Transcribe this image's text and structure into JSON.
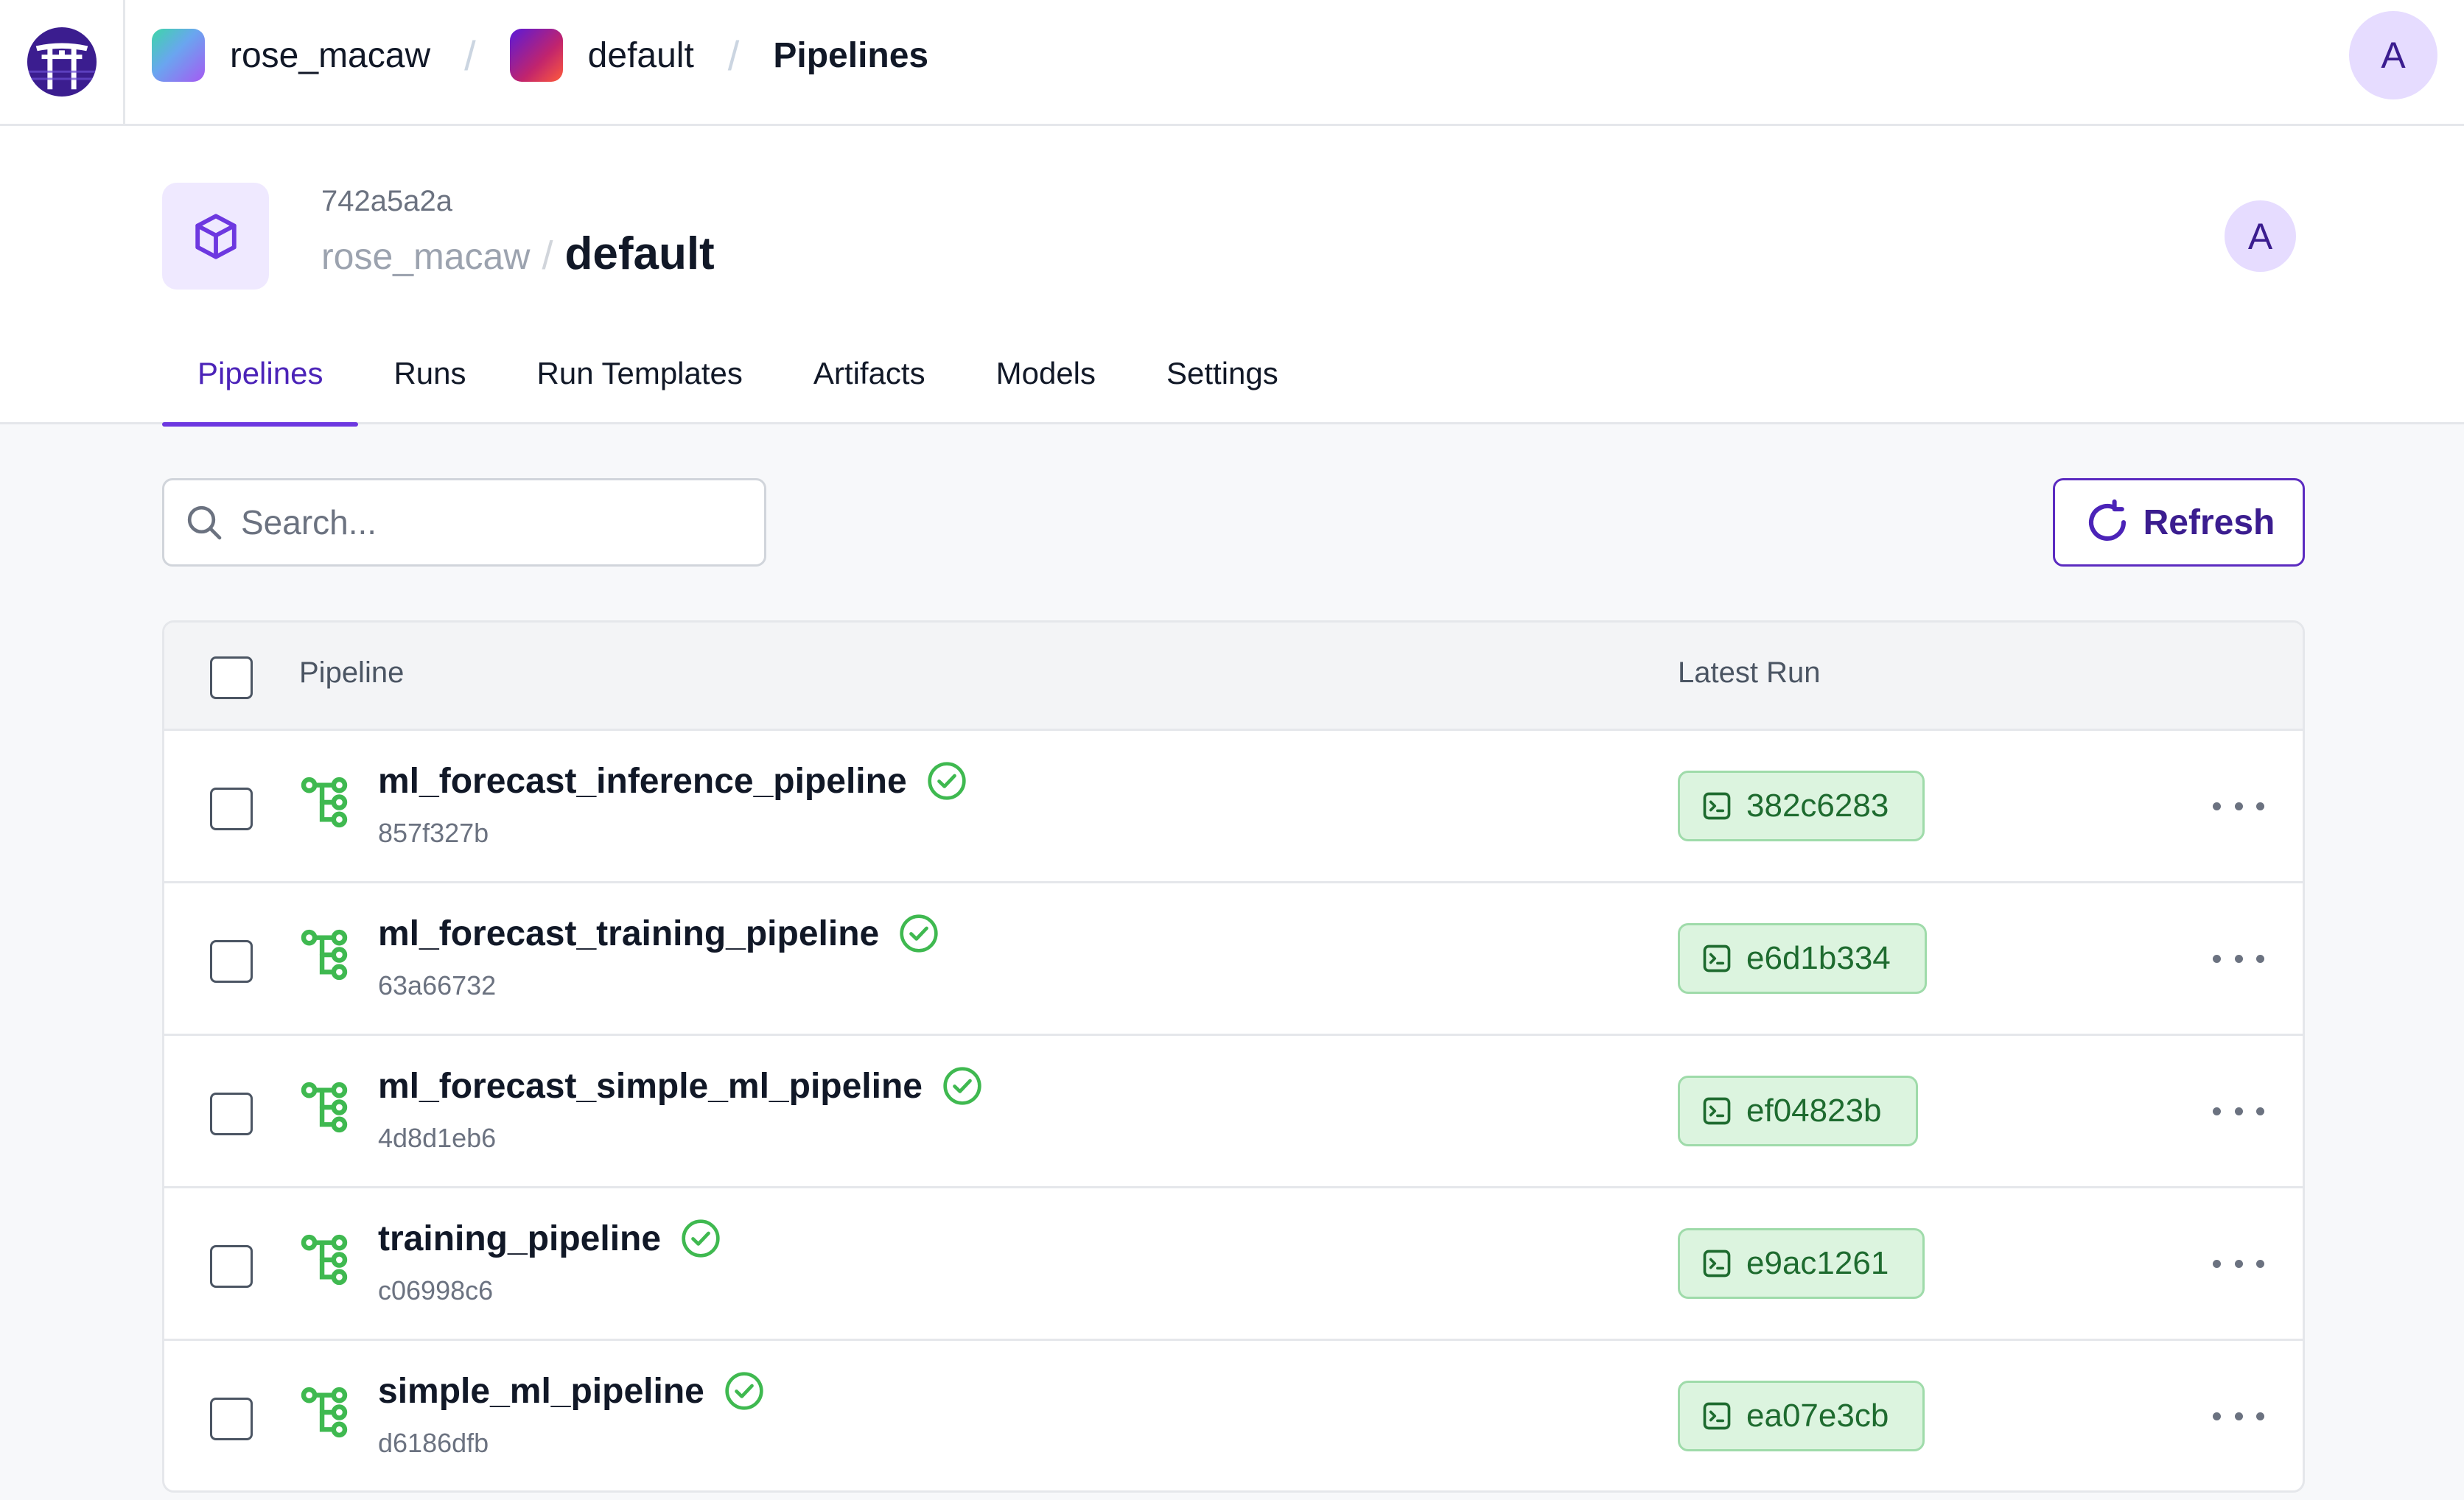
{
  "topbar": {
    "breadcrumb": {
      "tenant": "rose_macaw",
      "workspace": "default",
      "page": "Pipelines",
      "separator": "/"
    },
    "avatar_initial": "A"
  },
  "project": {
    "id": "742a5a2a",
    "parent": "rose_macaw",
    "separator": "/",
    "name": "default",
    "avatar_initial": "A",
    "tabs": [
      "Pipelines",
      "Runs",
      "Run Templates",
      "Artifacts",
      "Models",
      "Settings"
    ],
    "active_tab": "Pipelines"
  },
  "toolbar": {
    "search_placeholder": "Search...",
    "search_value": "",
    "refresh_label": "Refresh"
  },
  "table": {
    "columns": [
      "Pipeline",
      "Latest Run"
    ],
    "rows": [
      {
        "name": "ml_forecast_inference_pipeline",
        "id": "857f327b",
        "status": "completed",
        "latest_run": "382c6283"
      },
      {
        "name": "ml_forecast_training_pipeline",
        "id": "63a66732",
        "status": "completed",
        "latest_run": "e6d1b334"
      },
      {
        "name": "ml_forecast_simple_ml_pipeline",
        "id": "4d8d1eb6",
        "status": "completed",
        "latest_run": "ef04823b"
      },
      {
        "name": "training_pipeline",
        "id": "c06998c6",
        "status": "completed",
        "latest_run": "e9ac1261"
      },
      {
        "name": "simple_ml_pipeline",
        "id": "d6186dfb",
        "status": "completed",
        "latest_run": "ea07e3cb"
      }
    ]
  },
  "colors": {
    "brand_purple": "#4b23b8",
    "success_green": "#3fb950",
    "badge_bg": "#dcf4df"
  },
  "icons": {
    "logo": "torii-gate-logo-icon",
    "project": "cube-icon",
    "search": "search-icon",
    "refresh": "refresh-icon",
    "pipeline": "pipeline-tree-icon",
    "status": "check-circle-icon",
    "run": "terminal-icon",
    "row_menu": "more-horizontal-icon"
  }
}
